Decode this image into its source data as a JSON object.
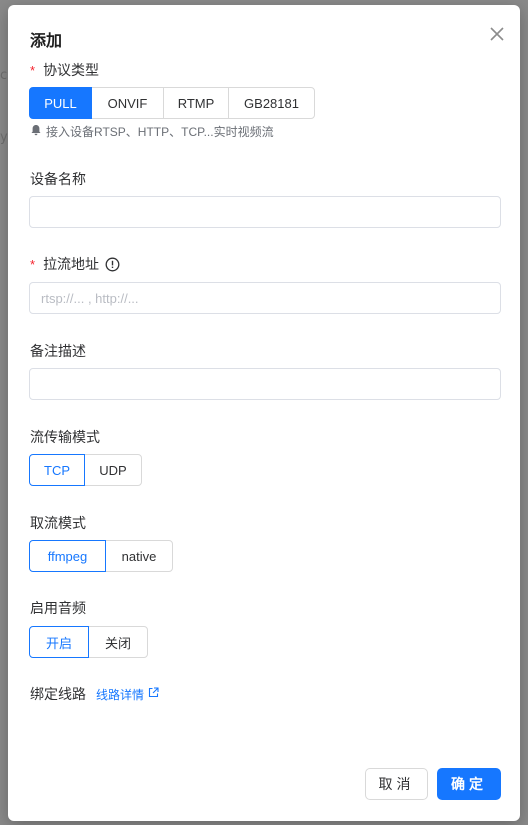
{
  "background": {
    "fragment_1": "c",
    "fragment_2": "y"
  },
  "dialog": {
    "title": "添加",
    "close_icon": "close-icon"
  },
  "protocol": {
    "required_mark": "*",
    "label": "协议类型",
    "options": [
      "PULL",
      "ONVIF",
      "RTMP",
      "GB28181"
    ],
    "selected": "PULL",
    "hint": "接入设备RTSP、HTTP、TCP...实时视频流",
    "hint_icon": "bell-icon"
  },
  "device_name": {
    "label": "设备名称",
    "value": "",
    "placeholder": ""
  },
  "pull_url": {
    "required_mark": "*",
    "label": "拉流地址",
    "info_icon": "info-circle-icon",
    "value": "",
    "placeholder": "rtsp://... , http://..."
  },
  "remark": {
    "label": "备注描述",
    "value": "",
    "placeholder": ""
  },
  "transport_mode": {
    "label": "流传输模式",
    "options": [
      "TCP",
      "UDP"
    ],
    "selected": "TCP"
  },
  "pull_mode": {
    "label": "取流模式",
    "options": [
      "ffmpeg",
      "native"
    ],
    "selected": "ffmpeg"
  },
  "audio": {
    "label": "启用音频",
    "options": [
      "开启",
      "关闭"
    ],
    "selected": "开启"
  },
  "route": {
    "label": "绑定线路",
    "link": "线路详情",
    "link_icon": "external-link-icon"
  },
  "footer": {
    "cancel": "取消",
    "ok": "确定"
  },
  "colors": {
    "primary": "#1677ff",
    "required": "#f5222d",
    "border": "#d9d9d9"
  }
}
